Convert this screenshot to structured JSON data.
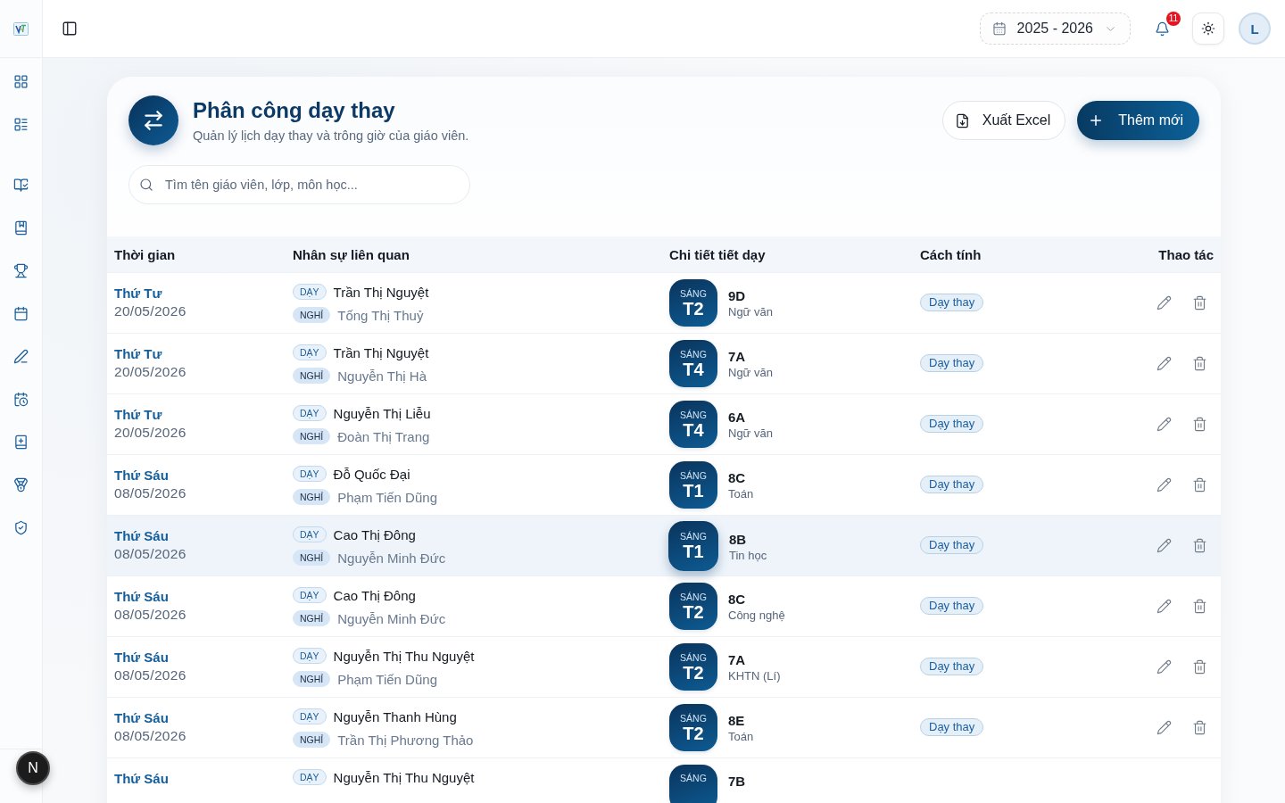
{
  "header": {
    "year_selector": {
      "value": "2025 - 2026"
    },
    "notifications": {
      "count": "11"
    },
    "avatar": {
      "initial": "L"
    }
  },
  "page": {
    "title": "Phân công dạy thay",
    "subtitle": "Quản lý lịch dạy thay và trông giờ của giáo viên.",
    "buttons": [
      {
        "kind": "outline",
        "label": "Xuất Excel"
      },
      {
        "kind": "primary",
        "label": "Thêm mới"
      }
    ],
    "search": {
      "placeholder": "Tìm tên giáo viên, lớp, môn học..."
    }
  },
  "table": {
    "columns": [
      "Thời gian",
      "Nhân sự liên quan",
      "Chi tiết tiết dạy",
      "Cách tính",
      "Thao tác"
    ],
    "rows": [
      {
        "weekday": "Thứ Tư",
        "date": "20/05/2026",
        "people": [
          {
            "kind": "teaching",
            "tag": "DẠY",
            "name": "Trần Thị Nguyệt"
          },
          {
            "kind": "absent",
            "tag": "NGHỈ",
            "name": "Tống Thị Thuỷ"
          }
        ],
        "session": "SÁNG",
        "period": "T2",
        "class": "9D",
        "subject": "Ngữ văn",
        "method": "Dạy thay",
        "selected": false
      },
      {
        "weekday": "Thứ Tư",
        "date": "20/05/2026",
        "people": [
          {
            "kind": "teaching",
            "tag": "DẠY",
            "name": "Trần Thị Nguyệt"
          },
          {
            "kind": "absent",
            "tag": "NGHỈ",
            "name": "Nguyễn Thị Hà"
          }
        ],
        "session": "SÁNG",
        "period": "T4",
        "class": "7A",
        "subject": "Ngữ văn",
        "method": "Dạy thay",
        "selected": false
      },
      {
        "weekday": "Thứ Tư",
        "date": "20/05/2026",
        "people": [
          {
            "kind": "teaching",
            "tag": "DẠY",
            "name": "Nguyễn Thị Liễu"
          },
          {
            "kind": "absent",
            "tag": "NGHỈ",
            "name": "Đoàn Thị Trang"
          }
        ],
        "session": "SÁNG",
        "period": "T4",
        "class": "6A",
        "subject": "Ngữ văn",
        "method": "Dạy thay",
        "selected": false
      },
      {
        "weekday": "Thứ Sáu",
        "date": "08/05/2026",
        "people": [
          {
            "kind": "teaching",
            "tag": "DẠY",
            "name": "Đỗ Quốc Đại"
          },
          {
            "kind": "absent",
            "tag": "NGHỈ",
            "name": "Phạm Tiến Dũng"
          }
        ],
        "session": "SÁNG",
        "period": "T1",
        "class": "8C",
        "subject": "Toán",
        "method": "Dạy thay",
        "selected": false
      },
      {
        "weekday": "Thứ Sáu",
        "date": "08/05/2026",
        "people": [
          {
            "kind": "teaching",
            "tag": "DẠY",
            "name": "Cao Thị Đông"
          },
          {
            "kind": "absent",
            "tag": "NGHỈ",
            "name": "Nguyễn Minh Đức"
          }
        ],
        "session": "SÁNG",
        "period": "T1",
        "class": "8B",
        "subject": "Tin học",
        "method": "Dạy thay",
        "selected": true
      },
      {
        "weekday": "Thứ Sáu",
        "date": "08/05/2026",
        "people": [
          {
            "kind": "teaching",
            "tag": "DẠY",
            "name": "Cao Thị Đông"
          },
          {
            "kind": "absent",
            "tag": "NGHỈ",
            "name": "Nguyễn Minh Đức"
          }
        ],
        "session": "SÁNG",
        "period": "T2",
        "class": "8C",
        "subject": "Công nghệ",
        "method": "Dạy thay",
        "selected": false
      },
      {
        "weekday": "Thứ Sáu",
        "date": "08/05/2026",
        "people": [
          {
            "kind": "teaching",
            "tag": "DẠY",
            "name": "Nguyễn Thị Thu Nguyệt"
          },
          {
            "kind": "absent",
            "tag": "NGHỈ",
            "name": "Phạm Tiến Dũng"
          }
        ],
        "session": "SÁNG",
        "period": "T2",
        "class": "7A",
        "subject": "KHTN (Lí)",
        "method": "Dạy thay",
        "selected": false
      },
      {
        "weekday": "Thứ Sáu",
        "date": "08/05/2026",
        "people": [
          {
            "kind": "teaching",
            "tag": "DẠY",
            "name": "Nguyễn Thanh Hùng"
          },
          {
            "kind": "absent",
            "tag": "NGHỈ",
            "name": "Trần Thị Phương Thảo"
          }
        ],
        "session": "SÁNG",
        "period": "T2",
        "class": "8E",
        "subject": "Toán",
        "method": "Dạy thay",
        "selected": false
      },
      {
        "weekday": "Thứ Sáu",
        "people": [
          {
            "kind": "teaching",
            "tag": "DẠY",
            "name": "Nguyễn Thị Thu Nguyệt"
          }
        ],
        "session": "SÁNG",
        "class": "7B",
        "selected": false
      }
    ]
  },
  "dev_indicator": {
    "label": "N"
  }
}
